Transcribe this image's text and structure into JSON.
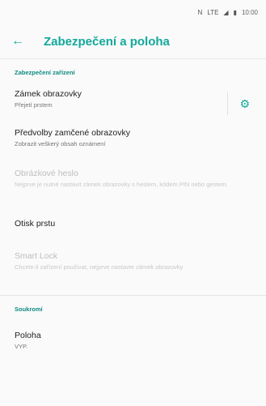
{
  "status": {
    "network": "N",
    "lte": "LTE",
    "time": "10:00"
  },
  "app_bar": {
    "title": "Zabezpečení a poloha"
  },
  "sections": [
    {
      "header": "Zabezpečení zařízení",
      "items": [
        {
          "title": "Zámek obrazovky",
          "subtitle": "Přejetí prstem",
          "enabled": true,
          "has_gear": true
        },
        {
          "title": "Předvolby zamčené obrazovky",
          "subtitle": "Zobrazit veškerý obsah oznámení",
          "enabled": true
        },
        {
          "title": "Obrázkové heslo",
          "subtitle": "Nejprve je nutné nastavit zámek obrazovky s heslem, kódem PIN nebo gestem.",
          "enabled": false
        },
        {
          "title": "Otisk prstu",
          "subtitle": "",
          "enabled": true
        },
        {
          "title": "Smart Lock",
          "subtitle": "Chcete-li zařízení používat, nejprve nastavte zámek obrazovky",
          "enabled": false
        }
      ]
    },
    {
      "header": "Soukromí",
      "items": [
        {
          "title": "Poloha",
          "subtitle": "VYP.",
          "enabled": true
        }
      ]
    }
  ],
  "icons": {
    "back": "arrow-left-icon",
    "gear": "gear-icon"
  },
  "colors": {
    "accent": "#12a89b",
    "section_header": "#0e8b81"
  }
}
